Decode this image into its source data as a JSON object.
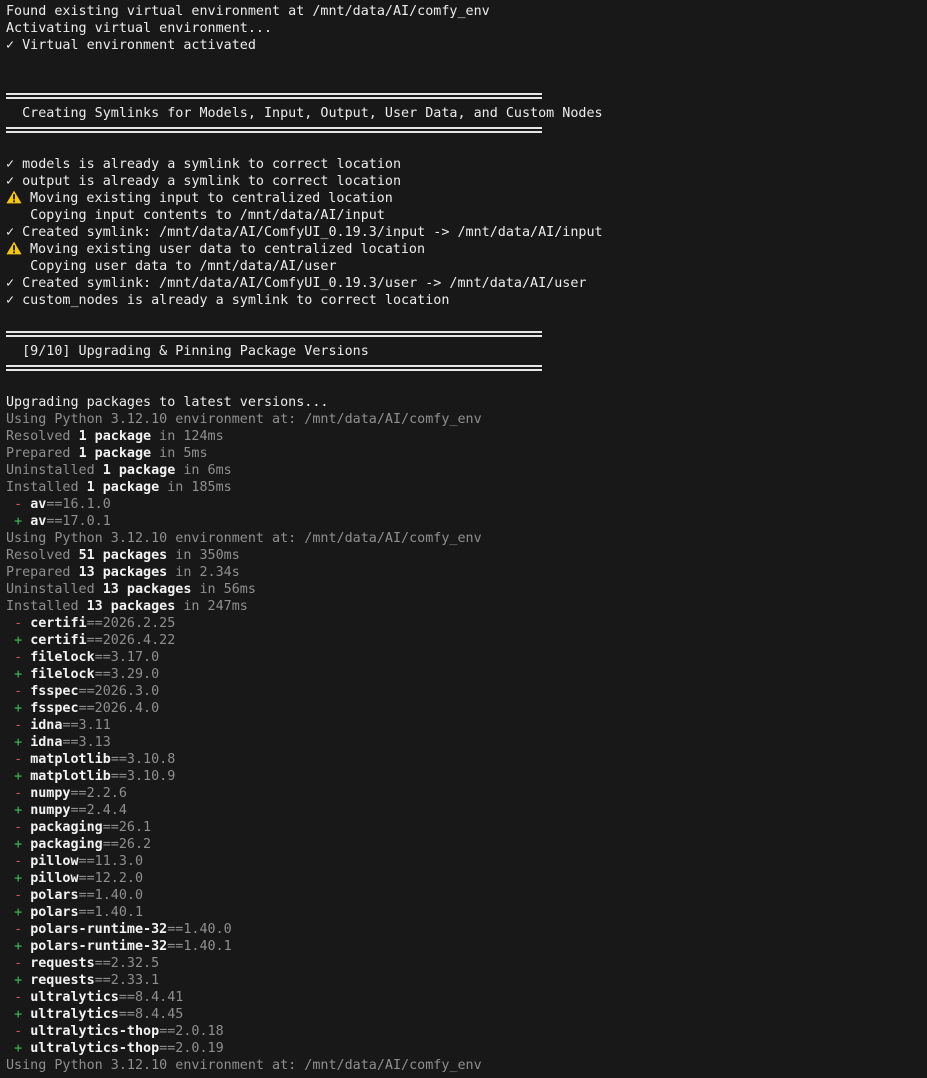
{
  "lines": [
    {
      "type": "text",
      "text": "Found existing virtual environment at /mnt/data/AI/comfy_env"
    },
    {
      "type": "text",
      "text": "Activating virtual environment..."
    },
    {
      "type": "text",
      "text": "✓ Virtual environment activated"
    },
    {
      "type": "blank"
    },
    {
      "type": "blank"
    },
    {
      "type": "rule"
    },
    {
      "type": "text",
      "text": "  Creating Symlinks for Models, Input, Output, User Data, and Custom Nodes"
    },
    {
      "type": "rule"
    },
    {
      "type": "blank"
    },
    {
      "type": "text",
      "text": "✓ models is already a symlink to correct location"
    },
    {
      "type": "text",
      "text": "✓ output is already a symlink to correct location"
    },
    {
      "type": "warn",
      "text": "Moving existing input to centralized location"
    },
    {
      "type": "text",
      "text": "   Copying input contents to /mnt/data/AI/input"
    },
    {
      "type": "text",
      "text": "✓ Created symlink: /mnt/data/AI/ComfyUI_0.19.3/input -> /mnt/data/AI/input"
    },
    {
      "type": "warn",
      "text": "Moving existing user data to centralized location"
    },
    {
      "type": "text",
      "text": "   Copying user data to /mnt/data/AI/user"
    },
    {
      "type": "text",
      "text": "✓ Created symlink: /mnt/data/AI/ComfyUI_0.19.3/user -> /mnt/data/AI/user"
    },
    {
      "type": "text",
      "text": "✓ custom_nodes is already a symlink to correct location"
    },
    {
      "type": "blank"
    },
    {
      "type": "rule"
    },
    {
      "type": "text",
      "text": "  [9/10] Upgrading & Pinning Package Versions"
    },
    {
      "type": "rule"
    },
    {
      "type": "blank"
    },
    {
      "type": "text",
      "text": "Upgrading packages to latest versions..."
    },
    {
      "type": "dim",
      "text": "Using Python 3.12.10 environment at: /mnt/data/AI/comfy_env"
    },
    {
      "type": "stat",
      "pre": "Resolved ",
      "bold": "1 package",
      "post": " in 124ms"
    },
    {
      "type": "stat",
      "pre": "Prepared ",
      "bold": "1 package",
      "post": " in 5ms"
    },
    {
      "type": "stat",
      "pre": "Uninstalled ",
      "bold": "1 package",
      "post": " in 6ms"
    },
    {
      "type": "stat",
      "pre": "Installed ",
      "bold": "1 package",
      "post": " in 185ms"
    },
    {
      "type": "pkg",
      "sign": "-",
      "name": "av",
      "ver": "==16.1.0"
    },
    {
      "type": "pkg",
      "sign": "+",
      "name": "av",
      "ver": "==17.0.1"
    },
    {
      "type": "dim",
      "text": "Using Python 3.12.10 environment at: /mnt/data/AI/comfy_env"
    },
    {
      "type": "stat",
      "pre": "Resolved ",
      "bold": "51 packages",
      "post": " in 350ms"
    },
    {
      "type": "stat",
      "pre": "Prepared ",
      "bold": "13 packages",
      "post": " in 2.34s"
    },
    {
      "type": "stat",
      "pre": "Uninstalled ",
      "bold": "13 packages",
      "post": " in 56ms"
    },
    {
      "type": "stat",
      "pre": "Installed ",
      "bold": "13 packages",
      "post": " in 247ms"
    },
    {
      "type": "pkg",
      "sign": "-",
      "name": "certifi",
      "ver": "==2026.2.25"
    },
    {
      "type": "pkg",
      "sign": "+",
      "name": "certifi",
      "ver": "==2026.4.22"
    },
    {
      "type": "pkg",
      "sign": "-",
      "name": "filelock",
      "ver": "==3.17.0"
    },
    {
      "type": "pkg",
      "sign": "+",
      "name": "filelock",
      "ver": "==3.29.0"
    },
    {
      "type": "pkg",
      "sign": "-",
      "name": "fsspec",
      "ver": "==2026.3.0"
    },
    {
      "type": "pkg",
      "sign": "+",
      "name": "fsspec",
      "ver": "==2026.4.0"
    },
    {
      "type": "pkg",
      "sign": "-",
      "name": "idna",
      "ver": "==3.11"
    },
    {
      "type": "pkg",
      "sign": "+",
      "name": "idna",
      "ver": "==3.13"
    },
    {
      "type": "pkg",
      "sign": "-",
      "name": "matplotlib",
      "ver": "==3.10.8"
    },
    {
      "type": "pkg",
      "sign": "+",
      "name": "matplotlib",
      "ver": "==3.10.9"
    },
    {
      "type": "pkg",
      "sign": "-",
      "name": "numpy",
      "ver": "==2.2.6"
    },
    {
      "type": "pkg",
      "sign": "+",
      "name": "numpy",
      "ver": "==2.4.4"
    },
    {
      "type": "pkg",
      "sign": "-",
      "name": "packaging",
      "ver": "==26.1"
    },
    {
      "type": "pkg",
      "sign": "+",
      "name": "packaging",
      "ver": "==26.2"
    },
    {
      "type": "pkg",
      "sign": "-",
      "name": "pillow",
      "ver": "==11.3.0"
    },
    {
      "type": "pkg",
      "sign": "+",
      "name": "pillow",
      "ver": "==12.2.0"
    },
    {
      "type": "pkg",
      "sign": "-",
      "name": "polars",
      "ver": "==1.40.0"
    },
    {
      "type": "pkg",
      "sign": "+",
      "name": "polars",
      "ver": "==1.40.1"
    },
    {
      "type": "pkg",
      "sign": "-",
      "name": "polars-runtime-32",
      "ver": "==1.40.0"
    },
    {
      "type": "pkg",
      "sign": "+",
      "name": "polars-runtime-32",
      "ver": "==1.40.1"
    },
    {
      "type": "pkg",
      "sign": "-",
      "name": "requests",
      "ver": "==2.32.5"
    },
    {
      "type": "pkg",
      "sign": "+",
      "name": "requests",
      "ver": "==2.33.1"
    },
    {
      "type": "pkg",
      "sign": "-",
      "name": "ultralytics",
      "ver": "==8.4.41"
    },
    {
      "type": "pkg",
      "sign": "+",
      "name": "ultralytics",
      "ver": "==8.4.45"
    },
    {
      "type": "pkg",
      "sign": "-",
      "name": "ultralytics-thop",
      "ver": "==2.0.18"
    },
    {
      "type": "pkg",
      "sign": "+",
      "name": "ultralytics-thop",
      "ver": "==2.0.19"
    },
    {
      "type": "dim",
      "text": "Using Python 3.12.10 environment at: /mnt/data/AI/comfy_env"
    }
  ],
  "colors": {
    "background": "#181818",
    "foreground": "#ececec",
    "dim": "#8f8f8f",
    "added": "#3fbf5a",
    "removed": "#d0575a",
    "warning": "#f5c518"
  },
  "icons": {
    "warning": "warning-icon"
  }
}
